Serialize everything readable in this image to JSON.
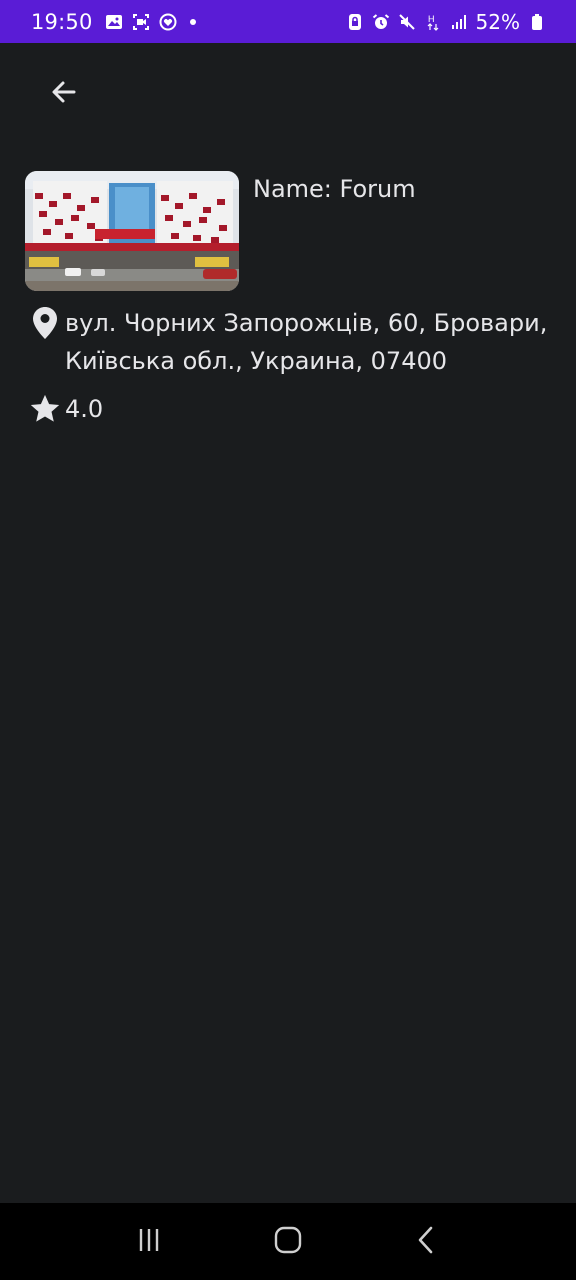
{
  "status_bar": {
    "time": "19:50",
    "battery_percent": "52%",
    "left_icons": [
      "gallery-icon",
      "screen-recorder-icon",
      "health-icon",
      "notification-dot"
    ],
    "right_icons": [
      "app-lock-icon",
      "alarm-icon",
      "mute-icon",
      "network-h-icon",
      "signal-icon",
      "battery-icon"
    ]
  },
  "app_bar": {
    "back_icon": "arrow-left-icon"
  },
  "place": {
    "name": "Name: Forum",
    "address": "вул. Чорних Запорожців, 60, Бровари, Київська обл., Украина, 07400",
    "rating": "4.0",
    "image_alt": "Forum shopping center photo"
  },
  "nav_bar": {
    "buttons": [
      "recent-apps-icon",
      "home-icon",
      "back-icon"
    ]
  },
  "colors": {
    "status_bar_bg": "#5a1cd6",
    "page_bg": "#1a1c1e",
    "text": "#e6e6e9",
    "nav_bar_bg": "#000000"
  }
}
